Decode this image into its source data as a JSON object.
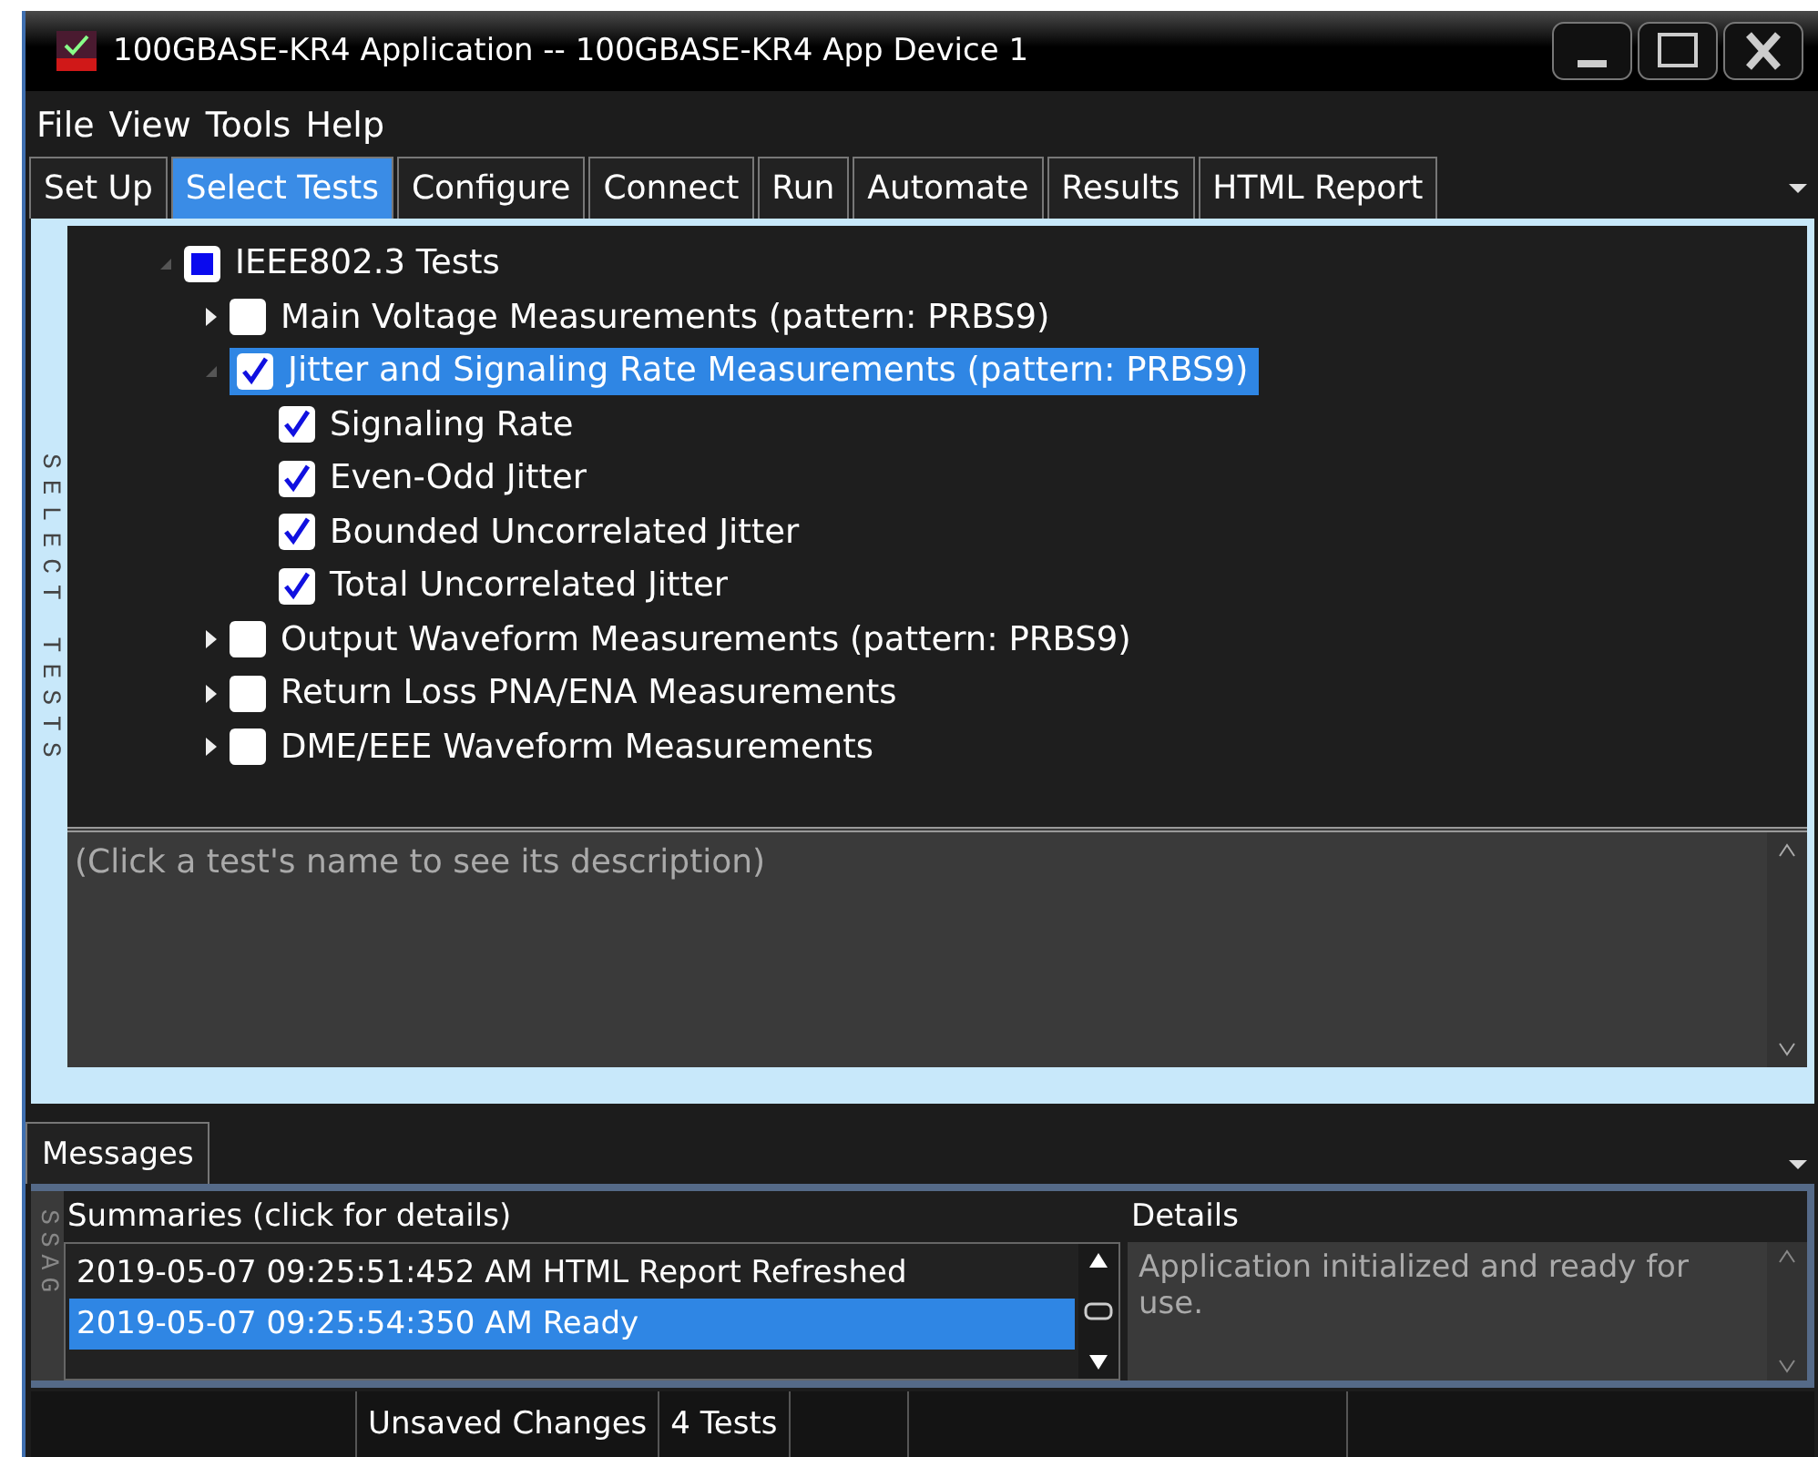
{
  "window": {
    "title": "100GBASE-KR4 Application -- 100GBASE-KR4 App Device 1"
  },
  "menu": [
    "File",
    "View",
    "Tools",
    "Help"
  ],
  "tabs": [
    {
      "label": "Set Up",
      "selected": false
    },
    {
      "label": "Select Tests",
      "selected": true
    },
    {
      "label": "Configure",
      "selected": false
    },
    {
      "label": "Connect",
      "selected": false
    },
    {
      "label": "Run",
      "selected": false
    },
    {
      "label": "Automate",
      "selected": false
    },
    {
      "label": "Results",
      "selected": false
    },
    {
      "label": "HTML Report",
      "selected": false
    }
  ],
  "side_label": "SELECT TESTS",
  "tree": [
    {
      "label": "IEEE802.3 Tests",
      "checked": false,
      "partial": true,
      "expanded": true,
      "selected": false,
      "children": [
        {
          "label": "Main Voltage Measurements (pattern: PRBS9)",
          "checked": false,
          "partial": false,
          "expanded": false,
          "selected": false
        },
        {
          "label": "Jitter and Signaling Rate Measurements (pattern: PRBS9)",
          "checked": true,
          "partial": false,
          "expanded": true,
          "selected": true,
          "children": [
            {
              "label": "Signaling Rate",
              "checked": true,
              "partial": false,
              "selected": false
            },
            {
              "label": "Even-Odd Jitter",
              "checked": true,
              "partial": false,
              "selected": false
            },
            {
              "label": "Bounded Uncorrelated Jitter",
              "checked": true,
              "partial": false,
              "selected": false
            },
            {
              "label": "Total Uncorrelated Jitter",
              "checked": true,
              "partial": false,
              "selected": false
            }
          ]
        },
        {
          "label": "Output Waveform Measurements (pattern: PRBS9)",
          "checked": false,
          "partial": false,
          "expanded": false,
          "selected": false
        },
        {
          "label": "Return Loss PNA/ENA Measurements",
          "checked": false,
          "partial": false,
          "expanded": false,
          "selected": false
        },
        {
          "label": "DME/EEE Waveform Measurements",
          "checked": false,
          "partial": false,
          "expanded": false,
          "selected": false
        }
      ]
    }
  ],
  "description": {
    "text": "(Click a test's name to see its description)"
  },
  "messages": {
    "tab": "Messages",
    "side_label": "SSAG",
    "summaries_header": "Summaries (click for details)",
    "details_header": "Details",
    "rows": [
      {
        "text": "2019-05-07 09:25:51:452 AM HTML Report Refreshed",
        "selected": false
      },
      {
        "text": "2019-05-07 09:25:54:350 AM Ready",
        "selected": true
      }
    ],
    "details": "Application initialized and ready for use."
  },
  "status_bar": [
    "Unsaved Changes",
    "4 Tests"
  ]
}
